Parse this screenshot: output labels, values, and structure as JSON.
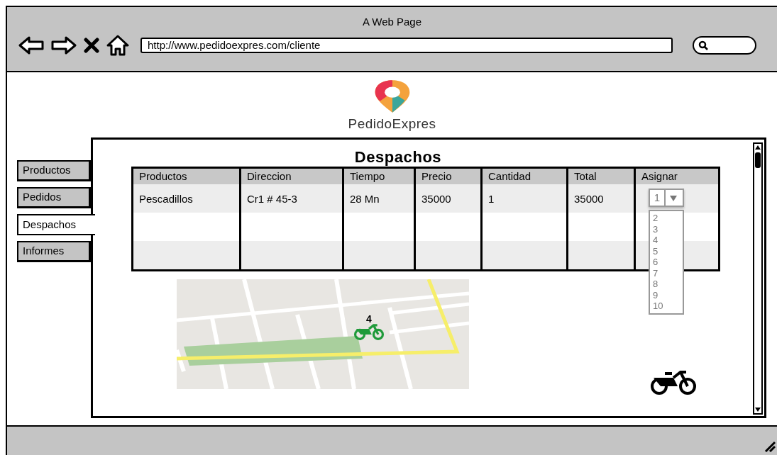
{
  "window": {
    "title": "A Web Page"
  },
  "browser": {
    "url": "http://www.pedidoexpres.com/cliente"
  },
  "brand": {
    "name": "PedidoExpres"
  },
  "tabs": [
    {
      "label": "Productos",
      "selected": false
    },
    {
      "label": "Pedidos",
      "selected": false
    },
    {
      "label": "Despachos",
      "selected": true
    },
    {
      "label": "Informes",
      "selected": false
    }
  ],
  "panel": {
    "title": "Despachos",
    "table": {
      "columns": [
        "Productos",
        "Direccion",
        "Tiempo",
        "Precio",
        "Cantidad",
        "Total",
        "Asignar"
      ],
      "rows": [
        {
          "cells": [
            "Pescadillos",
            "Cr1 # 45-3",
            "28 Mn",
            "35000",
            "1",
            "35000"
          ],
          "assign": {
            "value": "1",
            "expanded": true,
            "options": [
              "2",
              "3",
              "4",
              "5",
              "6",
              "7",
              "8",
              "9",
              "10"
            ]
          }
        }
      ]
    },
    "map": {
      "kind": "picture",
      "marker": {
        "label": "4"
      }
    }
  }
}
